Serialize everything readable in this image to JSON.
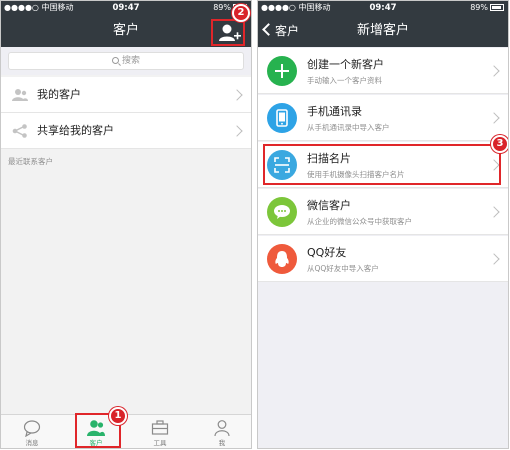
{
  "left_screen": {
    "status": {
      "carrier": "●●●●○ 中国移动",
      "time": "09:47",
      "battery": "89%"
    },
    "nav_title": "客户",
    "search_placeholder": "搜索",
    "items": [
      {
        "label": "我的客户"
      },
      {
        "label": "共享给我的客户"
      }
    ],
    "section_label": "最近联系客户",
    "tabs": [
      {
        "label": "消息"
      },
      {
        "label": "客户"
      },
      {
        "label": "工具"
      },
      {
        "label": "我"
      }
    ],
    "markers": {
      "tab": "1",
      "add_user": "2"
    }
  },
  "right_screen": {
    "status": {
      "carrier": "●●●●○ 中国移动",
      "time": "09:47",
      "battery": "89%"
    },
    "back_label": "客户",
    "nav_title": "新增客户",
    "options": [
      {
        "title": "创建一个新客户",
        "subtitle": "手动输入一个客户资料",
        "icon": "plus-icon",
        "color": "#27b24f"
      },
      {
        "title": "手机通讯录",
        "subtitle": "从手机通讯录中导入客户",
        "icon": "phone-icon",
        "color": "#2ea3e6"
      },
      {
        "title": "扫描名片",
        "subtitle": "使用手机摄像头扫描客户名片",
        "icon": "scan-icon",
        "color": "#3aa8e0"
      },
      {
        "title": "微信客户",
        "subtitle": "从企业的微信公众号中获取客户",
        "icon": "wechat-icon",
        "color": "#7cc63a"
      },
      {
        "title": "QQ好友",
        "subtitle": "从QQ好友中导入客户",
        "icon": "qq-icon",
        "color": "#ef5a3c"
      }
    ],
    "marker": "3"
  },
  "colors": {
    "navbar": "#333a40",
    "accent_green": "#29b36b",
    "highlight_red": "#e0262a"
  }
}
